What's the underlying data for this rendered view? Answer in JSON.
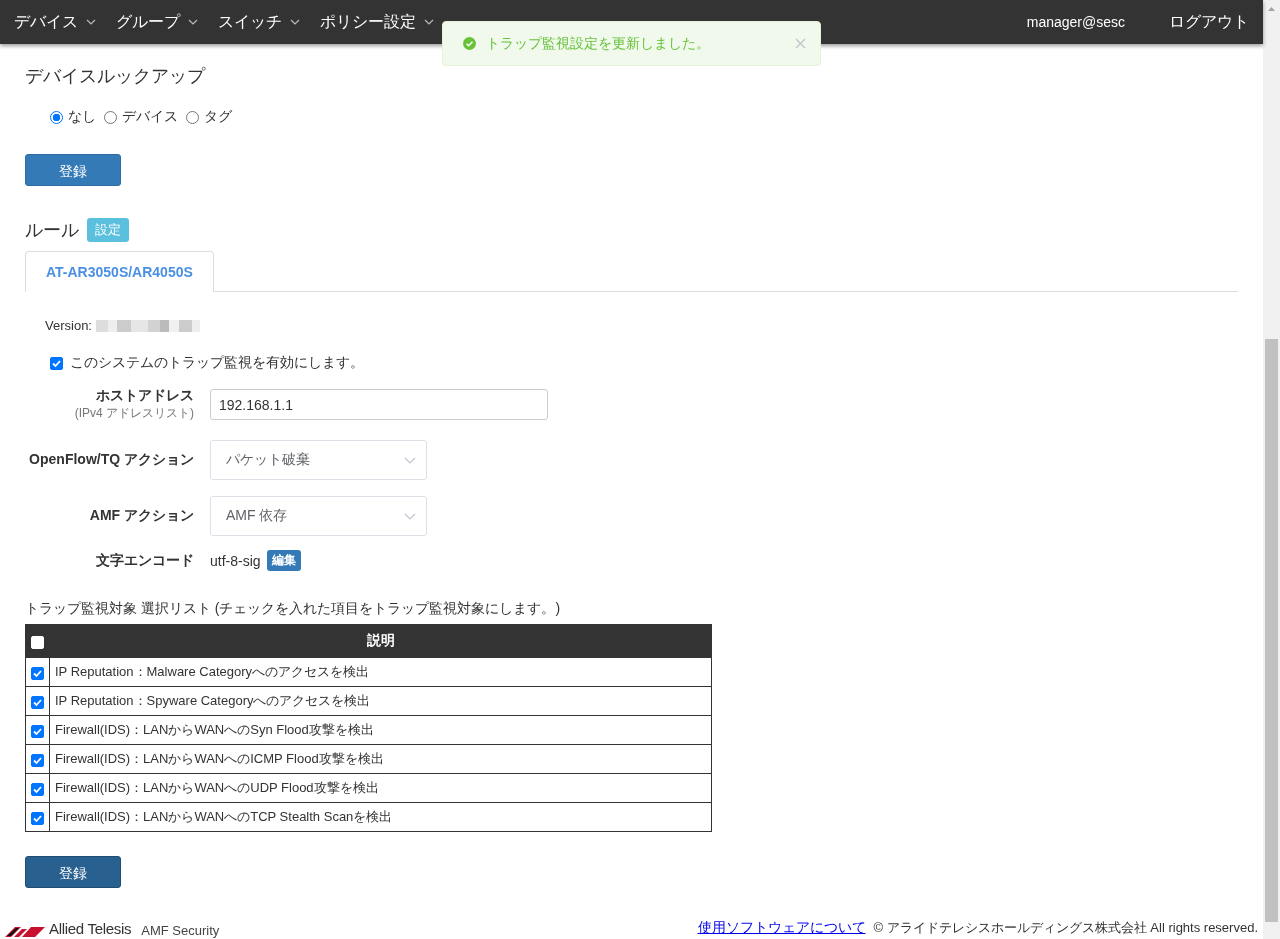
{
  "navbar": {
    "menus": [
      {
        "label": "デバイス"
      },
      {
        "label": "グループ"
      },
      {
        "label": "スイッチ"
      },
      {
        "label": "ポリシー設定"
      }
    ],
    "user": "manager@sesc",
    "logout": "ログアウト"
  },
  "toast": {
    "message": "トラップ監視設定を更新しました。"
  },
  "device_lookup": {
    "title": "デバイスルックアップ",
    "options": [
      {
        "label": "なし",
        "selected": true
      },
      {
        "label": "デバイス",
        "selected": false
      },
      {
        "label": "タグ",
        "selected": false
      }
    ],
    "submit": "登録"
  },
  "rules": {
    "title": "ルール",
    "settings_button": "設定",
    "tabs": [
      {
        "label": "AT-AR3050S/AR4050S",
        "selected": true
      }
    ],
    "version_label": "Version:",
    "enable": {
      "label": "このシステムのトラップ監視を有効にします。",
      "checked": true
    },
    "fields": [
      {
        "kind": "text",
        "label": "ホストアドレス",
        "hint": "(IPv4 アドレスリスト)",
        "value": "192.168.1.1"
      },
      {
        "kind": "select",
        "label": "OpenFlow/TQ アクション",
        "value": "パケット破棄"
      },
      {
        "kind": "select",
        "label": "AMF アクション",
        "value": "AMF 依存"
      },
      {
        "kind": "static",
        "label": "文字エンコード",
        "value": "utf-8-sig",
        "button": "編集"
      }
    ],
    "list_title": "トラップ監視対象 選択リスト (チェックを入れた項目をトラップ監視対象にします。)",
    "table": {
      "columns": [
        "説明"
      ],
      "header_checked": false,
      "rows": [
        {
          "checked": true,
          "text": "IP Reputation：Malware Categoryへのアクセスを検出"
        },
        {
          "checked": true,
          "text": "IP Reputation：Spyware Categoryへのアクセスを検出"
        },
        {
          "checked": true,
          "text": "Firewall(IDS)：LANからWANへのSyn Flood攻撃を検出"
        },
        {
          "checked": true,
          "text": "Firewall(IDS)：LANからWANへのICMP Flood攻撃を検出"
        },
        {
          "checked": true,
          "text": "Firewall(IDS)：LANからWANへのUDP Flood攻撃を検出"
        },
        {
          "checked": true,
          "text": "Firewall(IDS)：LANからWANへのTCP Stealth Scanを検出"
        }
      ]
    },
    "submit": "登録"
  },
  "footer": {
    "brand": "Allied Telesis",
    "product": "AMF Security",
    "link": "使用ソフトウェアについて",
    "copyright": "© アライドテレシスホールディングス株式会社 All rights reserved."
  }
}
